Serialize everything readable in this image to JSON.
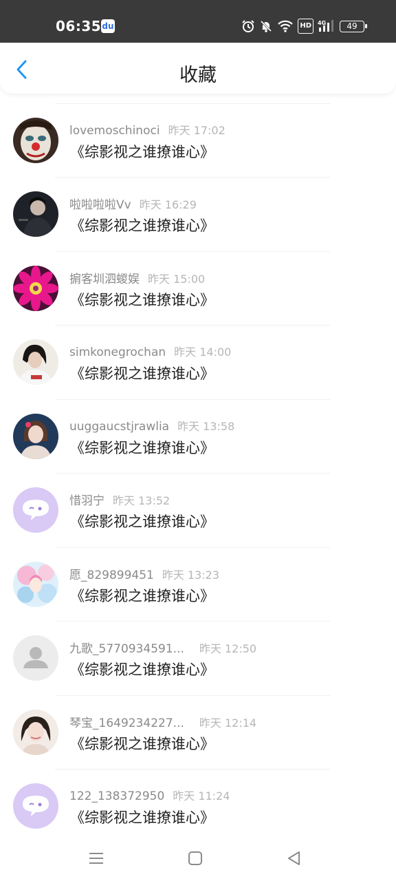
{
  "status_bar": {
    "time": "06:35",
    "app_icon": "baidu-icon",
    "battery": "49"
  },
  "header": {
    "title": "收藏",
    "back_icon": "chevron-left-icon"
  },
  "items": [
    {
      "name": "lovemoschinoci",
      "time": "昨天 17:02",
      "book": "《综影视之谁撩谁心》",
      "avatar": "photo-clown-avatar"
    },
    {
      "name": "啦啦啦啦Vv",
      "time": "昨天 16:29",
      "book": "《综影视之谁撩谁心》",
      "avatar": "photo-man-avatar"
    },
    {
      "name": "掮客圳泗蝬娱",
      "time": "昨天 15:00",
      "book": "《综影视之谁撩谁心》",
      "avatar": "photo-flower-avatar"
    },
    {
      "name": "simkonegrochan",
      "time": "昨天 14:00",
      "book": "《综影视之谁撩谁心》",
      "avatar": "photo-girl-avatar"
    },
    {
      "name": "uuggaucstjrawlia",
      "time": "昨天 13:58",
      "book": "《综影视之谁撩谁心》",
      "avatar": "photo-woman-avatar"
    },
    {
      "name": "惜羽宁",
      "time": "昨天 13:52",
      "book": "《综影视之谁撩谁心》",
      "avatar": "default-chat-avatar"
    },
    {
      "name": "愿_829899451",
      "time": "昨天 13:23",
      "book": "《综影视之谁撩谁心》",
      "avatar": "photo-anime-avatar"
    },
    {
      "name": "九歌_5770934591...",
      "time": "昨天 12:50",
      "book": "《综影视之谁撩谁心》",
      "avatar": "default-person-avatar"
    },
    {
      "name": "琴宝_1649234227...",
      "time": "昨天 12:14",
      "book": "《综影视之谁撩谁心》",
      "avatar": "photo-selfie-avatar"
    },
    {
      "name": "122_138372950",
      "time": "昨天 11:24",
      "book": "《综影视之谁撩谁心》",
      "avatar": "default-chat-avatar"
    }
  ],
  "nav": {
    "menu": "menu-icon",
    "home": "home-icon",
    "back": "back-triangle-icon"
  },
  "colors": {
    "accent": "#2196f3",
    "status_bar": "#3a3a3a",
    "default_avatar": "#d9c9f5"
  }
}
